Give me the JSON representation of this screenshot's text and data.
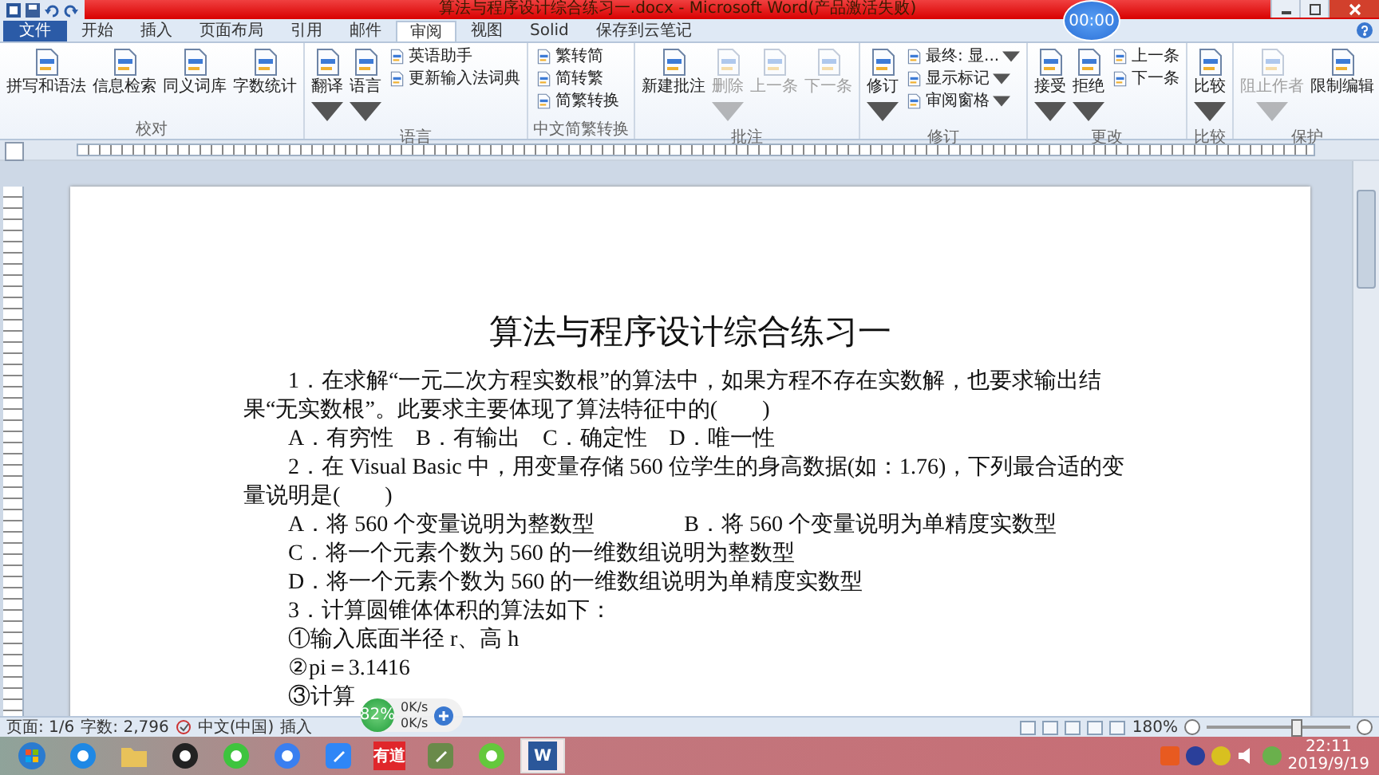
{
  "window": {
    "title": "算法与程序设计综合练习一.docx - Microsoft Word(产品激活失败)"
  },
  "timer": {
    "text": "00:00"
  },
  "tabs": [
    {
      "label": "文件",
      "selected": false,
      "kind": "file"
    },
    {
      "label": "开始",
      "selected": false,
      "kind": "tab"
    },
    {
      "label": "插入",
      "selected": false,
      "kind": "tab"
    },
    {
      "label": "页面布局",
      "selected": false,
      "kind": "tab"
    },
    {
      "label": "引用",
      "selected": false,
      "kind": "tab"
    },
    {
      "label": "邮件",
      "selected": false,
      "kind": "tab"
    },
    {
      "label": "审阅",
      "selected": true,
      "kind": "tab"
    },
    {
      "label": "视图",
      "selected": false,
      "kind": "tab"
    },
    {
      "label": "Solid",
      "selected": false,
      "kind": "tab"
    },
    {
      "label": "保存到云笔记",
      "selected": false,
      "kind": "tab"
    }
  ],
  "ribbon_groups": [
    {
      "label": "校对",
      "items": [
        {
          "kind": "big",
          "label": "拼写和语法",
          "disabled": false,
          "dropdown": false
        },
        {
          "kind": "big",
          "label": "信息检索",
          "disabled": false,
          "dropdown": false
        },
        {
          "kind": "big",
          "label": "同义词库",
          "disabled": false,
          "dropdown": false
        },
        {
          "kind": "big",
          "label": "字数统计",
          "disabled": false,
          "dropdown": false
        }
      ]
    },
    {
      "label": "语言",
      "items": [
        {
          "kind": "big",
          "label": "翻译",
          "disabled": false,
          "dropdown": true
        },
        {
          "kind": "big",
          "label": "语言",
          "disabled": false,
          "dropdown": true
        },
        {
          "kind": "small",
          "label": "英语助手",
          "disabled": false,
          "dropdown": false
        },
        {
          "kind": "small",
          "label": "更新输入法词典",
          "disabled": false,
          "dropdown": false
        }
      ]
    },
    {
      "label": "中文简繁转换",
      "items": [
        {
          "kind": "small",
          "label": "繁转简",
          "disabled": false,
          "dropdown": false
        },
        {
          "kind": "small",
          "label": "简转繁",
          "disabled": false,
          "dropdown": false
        },
        {
          "kind": "small",
          "label": "简繁转换",
          "disabled": false,
          "dropdown": false
        }
      ]
    },
    {
      "label": "批注",
      "items": [
        {
          "kind": "big",
          "label": "新建批注",
          "disabled": false,
          "dropdown": false
        },
        {
          "kind": "big",
          "label": "删除",
          "disabled": true,
          "dropdown": true
        },
        {
          "kind": "big",
          "label": "上一条",
          "disabled": true,
          "dropdown": false
        },
        {
          "kind": "big",
          "label": "下一条",
          "disabled": true,
          "dropdown": false
        }
      ]
    },
    {
      "label": "修订",
      "items": [
        {
          "kind": "big",
          "label": "修订",
          "disabled": false,
          "dropdown": true
        },
        {
          "kind": "small",
          "label": "最终: 显...",
          "disabled": false,
          "dropdown": true
        },
        {
          "kind": "small",
          "label": "显示标记",
          "disabled": false,
          "dropdown": true
        },
        {
          "kind": "small",
          "label": "审阅窗格",
          "disabled": false,
          "dropdown": true
        }
      ]
    },
    {
      "label": "更改",
      "items": [
        {
          "kind": "big",
          "label": "接受",
          "disabled": false,
          "dropdown": true
        },
        {
          "kind": "big",
          "label": "拒绝",
          "disabled": false,
          "dropdown": true
        },
        {
          "kind": "small",
          "label": "上一条",
          "disabled": false,
          "dropdown": false
        },
        {
          "kind": "small",
          "label": "下一条",
          "disabled": false,
          "dropdown": false
        }
      ]
    },
    {
      "label": "比较",
      "items": [
        {
          "kind": "big",
          "label": "比较",
          "disabled": false,
          "dropdown": true
        }
      ]
    },
    {
      "label": "保护",
      "items": [
        {
          "kind": "big",
          "label": "阻止作者",
          "disabled": true,
          "dropdown": true
        },
        {
          "kind": "big",
          "label": "限制编辑",
          "disabled": false,
          "dropdown": false
        }
      ]
    }
  ],
  "document": {
    "paragraphs": [
      {
        "kind": "title",
        "texts": [
          "算法与程序设计综合练习一"
        ]
      },
      {
        "kind": "indent",
        "texts": [
          "1．在求解“一元二次方程实数根”的算法中，如果方程不存在实数解，也要求输出结果“无实数根”。此要求主要体现了算法特征中的(　　)"
        ]
      },
      {
        "kind": "option",
        "texts": [
          "A．有穷性　B．有输出　C．确定性　D．唯一性"
        ]
      },
      {
        "kind": "indent",
        "texts": [
          "2．在 Visual Basic 中，用变量存储 560 位学生的身高数据(如：1.76)，下列最合适的变量说明是(　　)"
        ]
      },
      {
        "kind": "option",
        "texts": [
          "A．将 560 个变量说明为整数型",
          "B．将 560 个变量说明为单精度实数型"
        ]
      },
      {
        "kind": "option",
        "texts": [
          "C．将一个元素个数为 560 的一维数组说明为整数型"
        ]
      },
      {
        "kind": "option",
        "texts": [
          "D．将一个元素个数为 560 的一维数组说明为单精度实数型"
        ]
      },
      {
        "kind": "option",
        "texts": [
          "3．计算圆锥体体积的算法如下："
        ]
      },
      {
        "kind": "option",
        "texts": [
          "①输入底面半径 r、高 h"
        ]
      },
      {
        "kind": "option",
        "texts": [
          "②pi＝3.1416"
        ]
      },
      {
        "kind": "option",
        "texts": [
          "③计算"
        ]
      }
    ]
  },
  "status_bar": {
    "page": "页面: 1/6",
    "words": "字数: 2,796",
    "language": "中文(中国)",
    "mode": "插入",
    "zoom": "180%",
    "zoom_level": {
      "level": 0.62
    }
  },
  "net_widget": {
    "percent": "82%",
    "up": "0K/s",
    "down": "0K/s"
  },
  "taskbar": {
    "apps": [
      {
        "kind": "start",
        "color": "#2a7bd0",
        "selected": false
      },
      {
        "kind": "circle",
        "color": "#1e88e5",
        "selected": false
      },
      {
        "kind": "folder",
        "color": "#e8c25a",
        "selected": false
      },
      {
        "kind": "circle",
        "color": "#222222",
        "selected": false
      },
      {
        "kind": "circle",
        "color": "#3ec43e",
        "selected": false
      },
      {
        "kind": "circle",
        "color": "#3a7ff0",
        "selected": false
      },
      {
        "kind": "square",
        "color": "#2f86f6",
        "selected": false
      },
      {
        "kind": "label",
        "color": "#e0262b",
        "selected": false,
        "label": "有道"
      },
      {
        "kind": "square",
        "color": "#6a8a4a",
        "selected": false
      },
      {
        "kind": "circle",
        "color": "#64c83c",
        "selected": false
      },
      {
        "kind": "label",
        "color": "#2b579a",
        "selected": true,
        "label": "W"
      }
    ],
    "time": "22:11",
    "date": "2019/9/19"
  }
}
